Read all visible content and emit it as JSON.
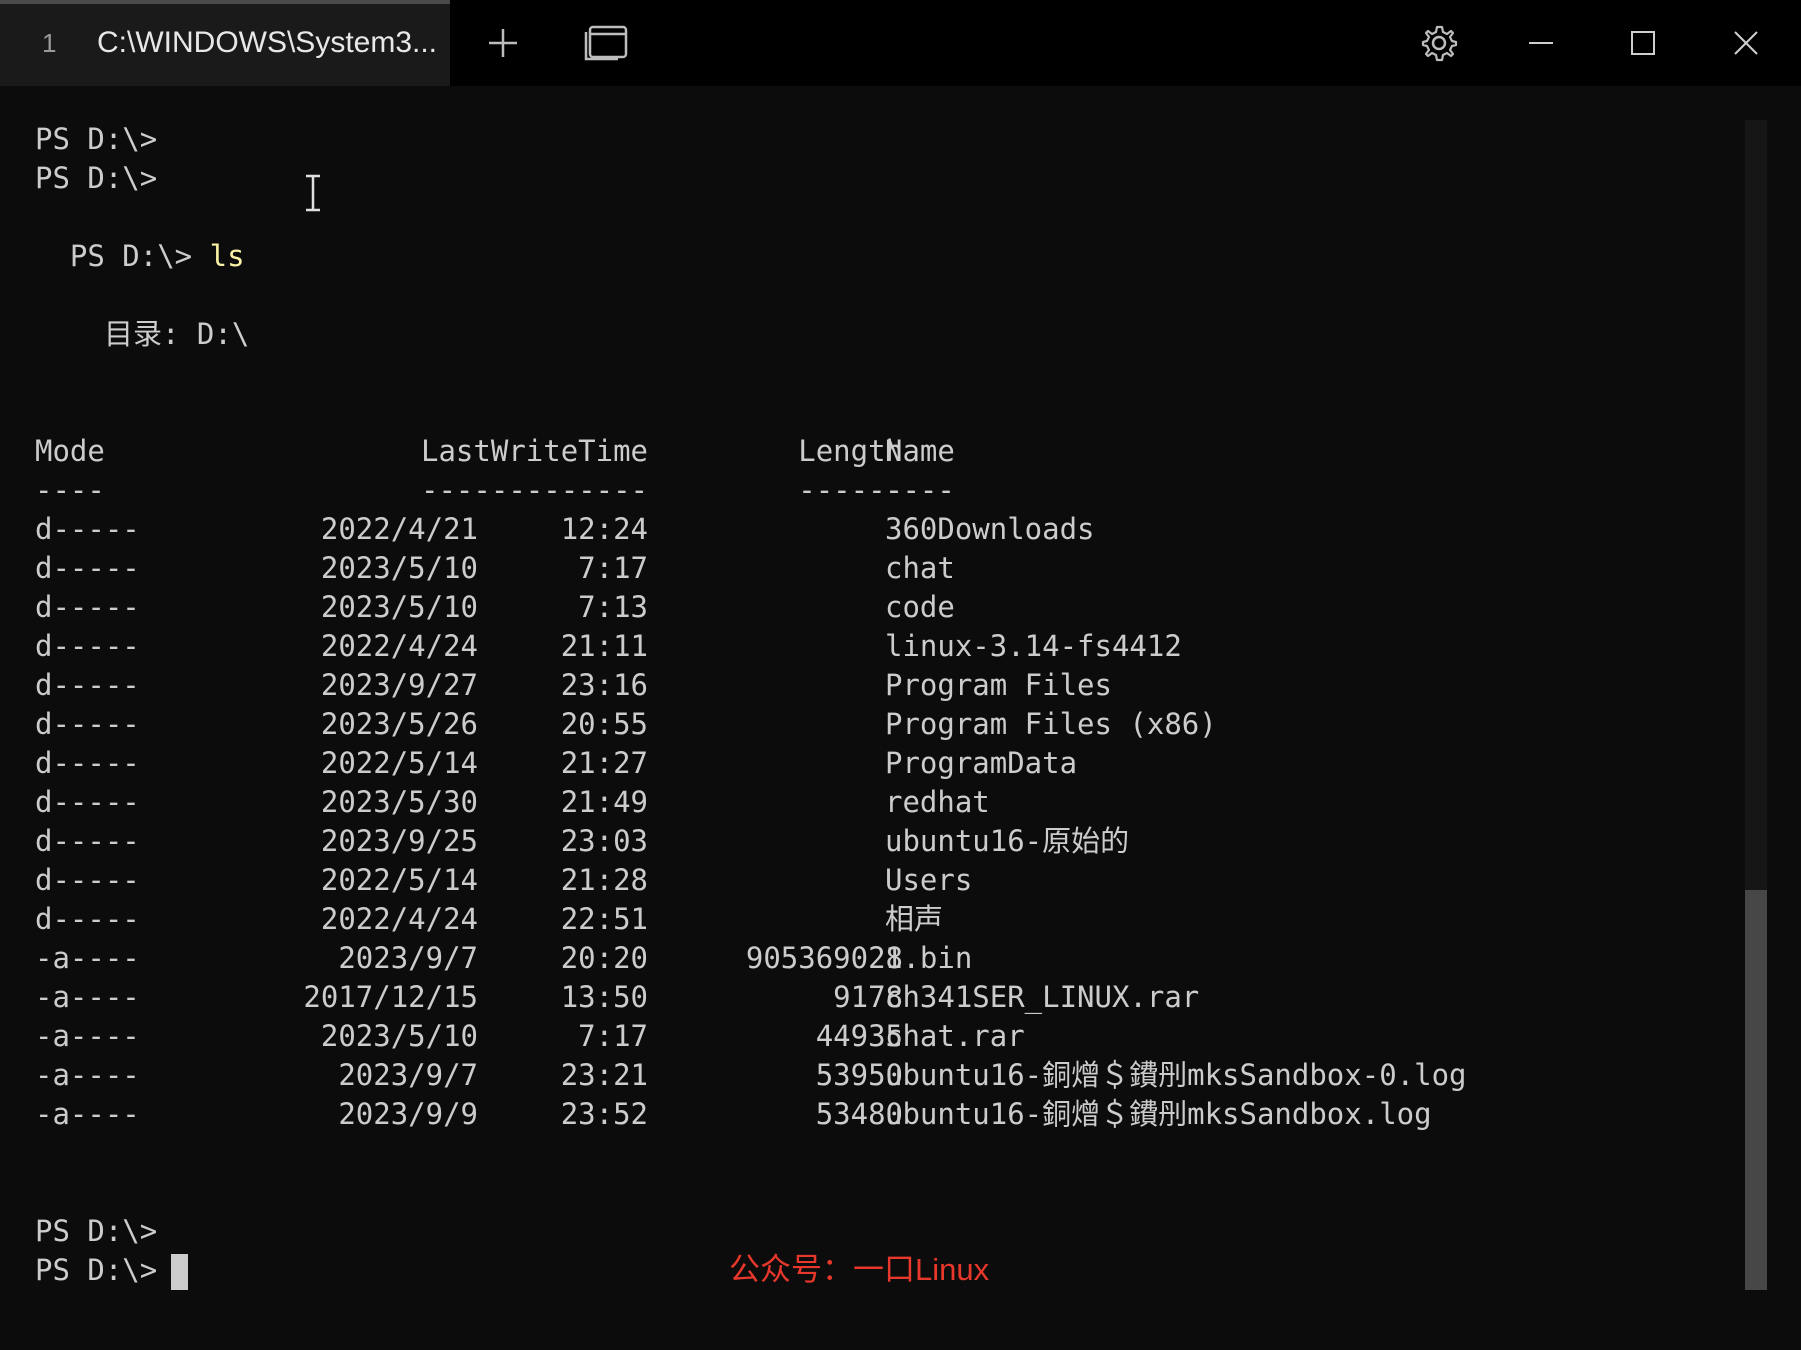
{
  "window": {
    "tab_index": "1",
    "tab_title": "C:\\WINDOWS\\System3...",
    "new_tab_icon": "plus-icon",
    "dropdown_icon": "tab-list-icon",
    "settings_icon": "gear-icon",
    "minimize_icon": "minimize-icon",
    "maximize_icon": "maximize-icon",
    "close_icon": "close-icon"
  },
  "terminal": {
    "prompts_before": [
      "PS D:\\>",
      "PS D:\\>"
    ],
    "prompt": "PS D:\\>",
    "command": "ls",
    "directory_label": "目录: D:\\",
    "headers": {
      "mode": "Mode",
      "lastwritetime": "LastWriteTime",
      "length": "Length",
      "name": "Name"
    },
    "separators": {
      "mode": "----",
      "lastwritetime": "-------------",
      "length": "------",
      "name": "----"
    },
    "rows": [
      {
        "mode": "d-----",
        "date": "2022/4/21",
        "time": "12:24",
        "length": "",
        "name": "360Downloads"
      },
      {
        "mode": "d-----",
        "date": "2023/5/10",
        "time": "7:17",
        "length": "",
        "name": "chat"
      },
      {
        "mode": "d-----",
        "date": "2023/5/10",
        "time": "7:13",
        "length": "",
        "name": "code"
      },
      {
        "mode": "d-----",
        "date": "2022/4/24",
        "time": "21:11",
        "length": "",
        "name": "linux-3.14-fs4412"
      },
      {
        "mode": "d-----",
        "date": "2023/9/27",
        "time": "23:16",
        "length": "",
        "name": "Program Files"
      },
      {
        "mode": "d-----",
        "date": "2023/5/26",
        "time": "20:55",
        "length": "",
        "name": "Program Files (x86)"
      },
      {
        "mode": "d-----",
        "date": "2022/5/14",
        "time": "21:27",
        "length": "",
        "name": "ProgramData"
      },
      {
        "mode": "d-----",
        "date": "2023/5/30",
        "time": "21:49",
        "length": "",
        "name": "redhat"
      },
      {
        "mode": "d-----",
        "date": "2023/9/25",
        "time": "23:03",
        "length": "",
        "name": "ubuntu16-原始的"
      },
      {
        "mode": "d-----",
        "date": "2022/5/14",
        "time": "21:28",
        "length": "",
        "name": "Users"
      },
      {
        "mode": "d-----",
        "date": "2022/4/24",
        "time": "22:51",
        "length": "",
        "name": "相声"
      },
      {
        "mode": "-a----",
        "date": "2023/9/7",
        "time": "20:20",
        "length": "905369028",
        "name": "1.bin"
      },
      {
        "mode": "-a----",
        "date": "2017/12/15",
        "time": "13:50",
        "length": "9178",
        "name": "ch341SER_LINUX.rar"
      },
      {
        "mode": "-a----",
        "date": "2023/5/10",
        "time": "7:17",
        "length": "44935",
        "name": "chat.rar"
      },
      {
        "mode": "-a----",
        "date": "2023/9/7",
        "time": "23:21",
        "length": "53950",
        "name": "ubuntu16-銅熷＄鐨刐mksSandbox-0.log"
      },
      {
        "mode": "-a----",
        "date": "2023/9/9",
        "time": "23:52",
        "length": "53480",
        "name": "ubuntu16-銅熷＄鐨刐mksSandbox.log"
      }
    ],
    "prompts_after": [
      "PS D:\\>",
      "PS D:\\>"
    ]
  },
  "watermark": "公众号：一口Linux",
  "colors": {
    "background": "#0c0c0c",
    "text": "#cccccc",
    "command": "#f9f1a5",
    "watermark": "#e8372b"
  }
}
